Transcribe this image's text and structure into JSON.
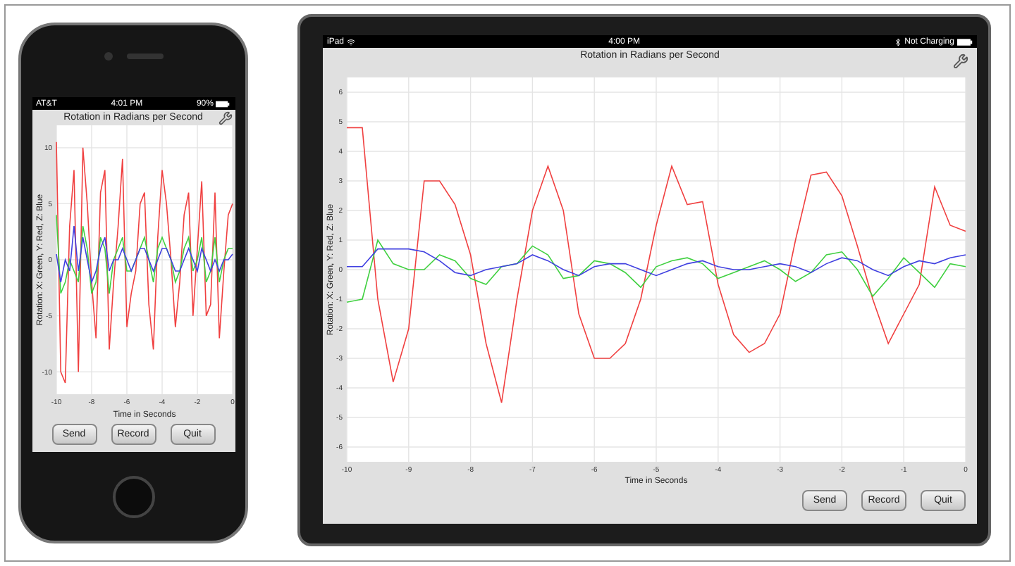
{
  "phone": {
    "status_bar": {
      "carrier": "AT&T",
      "time": "4:01 PM",
      "battery": "90%"
    },
    "title": "Rotation in Radians per Second",
    "chart_data": {
      "type": "line",
      "grid": true,
      "xlabel": "Time in Seconds",
      "ylabel": "Rotation: X: Green, Y: Red, Z: Blue",
      "xlim": [
        -10,
        0
      ],
      "ylim": [
        -12,
        12
      ],
      "xticks": [
        -10,
        -8,
        -6,
        -4,
        -2,
        0
      ],
      "yticks": [
        -10,
        -5,
        0,
        5,
        10
      ],
      "x": [
        -10,
        -9.75,
        -9.5,
        -9.25,
        -9,
        -8.75,
        -8.5,
        -8.25,
        -8,
        -7.75,
        -7.5,
        -7.25,
        -7,
        -6.75,
        -6.5,
        -6.25,
        -6,
        -5.75,
        -5.5,
        -5.25,
        -5,
        -4.75,
        -4.5,
        -4.25,
        -4,
        -3.75,
        -3.5,
        -3.25,
        -3,
        -2.75,
        -2.5,
        -2.25,
        -2,
        -1.75,
        -1.5,
        -1.25,
        -1,
        -0.75,
        -0.5,
        -0.25,
        0
      ],
      "series": [
        {
          "color": "#f04040",
          "values": [
            10.5,
            -10,
            -11,
            3,
            8,
            -10,
            10,
            5,
            -2,
            -7,
            6,
            8,
            -8,
            -2,
            3,
            9,
            -6,
            -3,
            -1,
            5,
            6,
            -4,
            -8,
            2,
            8,
            5,
            0,
            -6,
            -2,
            4,
            6,
            -5,
            1,
            7,
            -5,
            -4,
            6,
            -7,
            -1,
            4,
            5
          ]
        },
        {
          "color": "#40d040",
          "values": [
            4,
            -3,
            -2,
            0,
            -1,
            -2,
            3,
            1,
            -3,
            -2,
            2,
            1,
            -3,
            0,
            1,
            2,
            -1,
            -1,
            0,
            1,
            2,
            0,
            -2,
            1,
            2,
            1,
            0,
            -2,
            -1,
            1,
            2,
            -1,
            0,
            2,
            -2,
            -1,
            2,
            -2,
            0,
            1,
            1
          ]
        },
        {
          "color": "#4040e0",
          "values": [
            0.5,
            -2,
            0,
            -1,
            3,
            -1,
            2,
            0,
            -2,
            -1,
            1,
            2,
            -1,
            0,
            0,
            1,
            0,
            -1,
            0,
            1,
            1,
            0,
            -1,
            0,
            1,
            1,
            0,
            -1,
            -1,
            0,
            1,
            0,
            -1,
            1,
            0,
            -1,
            0,
            -1,
            0,
            0,
            0.5
          ]
        }
      ]
    },
    "buttons": [
      "Send",
      "Record",
      "Quit"
    ]
  },
  "tablet": {
    "status_bar": {
      "device": "iPad",
      "time": "4:00 PM",
      "charging": "Not Charging"
    },
    "title": "Rotation in Radians per Second",
    "chart_data": {
      "type": "line",
      "grid": true,
      "xlabel": "Time in Seconds",
      "ylabel": "Rotation: X: Green, Y: Red, Z: Blue",
      "xlim": [
        -10,
        0
      ],
      "ylim": [
        -6.5,
        6.5
      ],
      "xticks": [
        -10,
        -9,
        -8,
        -7,
        -6,
        -5,
        -4,
        -3,
        -2,
        -1,
        0
      ],
      "yticks": [
        -6,
        -5,
        -4,
        -3,
        -2,
        -1,
        0,
        1,
        2,
        3,
        4,
        5,
        6
      ],
      "x": [
        -10,
        -9.75,
        -9.5,
        -9.25,
        -9,
        -8.75,
        -8.5,
        -8.25,
        -8,
        -7.75,
        -7.5,
        -7.25,
        -7,
        -6.75,
        -6.5,
        -6.25,
        -6,
        -5.75,
        -5.5,
        -5.25,
        -5,
        -4.75,
        -4.5,
        -4.25,
        -4,
        -3.75,
        -3.5,
        -3.25,
        -3,
        -2.75,
        -2.5,
        -2.25,
        -2,
        -1.75,
        -1.5,
        -1.25,
        -1,
        -0.75,
        -0.5,
        -0.25,
        0
      ],
      "series": [
        {
          "color": "#f04040",
          "values": [
            4.8,
            4.8,
            -1,
            -3.8,
            -2,
            3,
            3,
            2.2,
            0.5,
            -2.5,
            -4.5,
            -1,
            2,
            3.5,
            2,
            -1.5,
            -3,
            -3,
            -2.5,
            -1,
            1.5,
            3.5,
            2.2,
            2.3,
            -0.5,
            -2.2,
            -2.8,
            -2.5,
            -1.5,
            1,
            3.2,
            3.3,
            2.5,
            0.8,
            -1,
            -2.5,
            -1.5,
            -0.5,
            2.8,
            1.5,
            1.3
          ]
        },
        {
          "color": "#40d040",
          "values": [
            -1.1,
            -1,
            1,
            0.2,
            0,
            0,
            0.5,
            0.3,
            -0.3,
            -0.5,
            0.1,
            0.2,
            0.8,
            0.5,
            -0.3,
            -0.2,
            0.3,
            0.2,
            -0.1,
            -0.6,
            0.1,
            0.3,
            0.4,
            0.2,
            -0.3,
            -0.1,
            0.1,
            0.3,
            0,
            -0.4,
            -0.1,
            0.5,
            0.6,
            0,
            -0.9,
            -0.3,
            0.4,
            -0.1,
            -0.6,
            0.2,
            0.1
          ]
        },
        {
          "color": "#4040e0",
          "values": [
            0.1,
            0.1,
            0.7,
            0.7,
            0.7,
            0.6,
            0.3,
            -0.1,
            -0.2,
            0,
            0.1,
            0.2,
            0.5,
            0.3,
            0,
            -0.2,
            0.1,
            0.2,
            0.2,
            0,
            -0.2,
            0,
            0.2,
            0.3,
            0.1,
            0,
            0,
            0.1,
            0.2,
            0.1,
            -0.1,
            0.2,
            0.4,
            0.3,
            0,
            -0.2,
            0.1,
            0.3,
            0.2,
            0.4,
            0.5
          ]
        }
      ]
    },
    "buttons": [
      "Send",
      "Record",
      "Quit"
    ]
  }
}
